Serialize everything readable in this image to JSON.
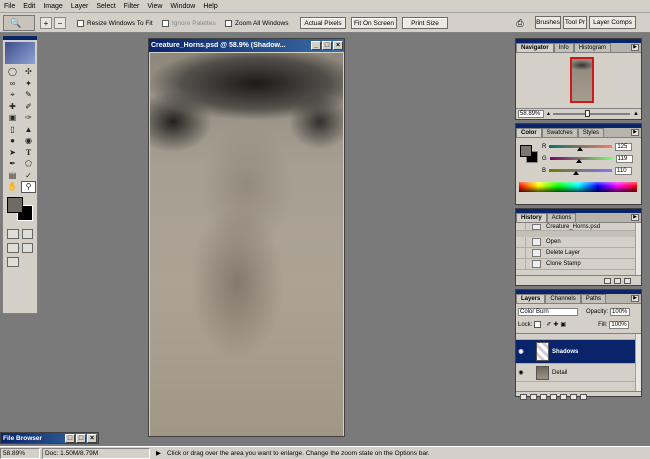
{
  "menu": [
    "File",
    "Edit",
    "Image",
    "Layer",
    "Select",
    "Filter",
    "View",
    "Window",
    "Help"
  ],
  "options": {
    "resize_windows_label": "Resize Windows To Fit",
    "ignore_palettes_label": "Ignore Palettes",
    "zoom_all_label": "Zoom All Windows",
    "actual_pixels_label": "Actual Pixels",
    "fit_on_screen_label": "Fit On Screen",
    "print_size_label": "Print Size",
    "well_tabs": [
      "Brushes",
      "Tool Pr",
      "Layer Comps"
    ]
  },
  "document": {
    "title": "Creature_Horns.psd @ 58.9% (Shadow..."
  },
  "navigator": {
    "tabs": [
      "Navigator",
      "Info",
      "Histogram"
    ],
    "zoom": "58.89%"
  },
  "color": {
    "tabs": [
      "Color",
      "Swatches",
      "Styles"
    ],
    "r_label": "R",
    "g_label": "G",
    "b_label": "B",
    "r": "125",
    "g": "119",
    "b": "110",
    "r_fraction": 0.49,
    "g_fraction": 0.47,
    "b_fraction": 0.43
  },
  "history": {
    "tabs": [
      "History",
      "Actions"
    ],
    "snapshot": "Creature_Horns.psd",
    "items": [
      "Open",
      "Delete Layer",
      "Clone Stamp"
    ]
  },
  "layers": {
    "tabs": [
      "Layers",
      "Channels",
      "Paths"
    ],
    "blend_mode": "Color Burn",
    "opacity_label": "Opacity:",
    "opacity": "100%",
    "lock_label": "Lock:",
    "fill_label": "Fill:",
    "fill": "100%",
    "items": [
      "Shadows",
      "Detail"
    ]
  },
  "file_browser": {
    "title": "File Browser"
  },
  "status": {
    "zoom": "58.89%",
    "doc": "Doc: 1.50M/8.79M",
    "hint": "Click or drag over the area you want to enlarge. Change the zoom state on the Options bar."
  },
  "colors": {
    "accent": "#0a246a",
    "chrome": "#d4d0c8",
    "workspace": "#7a7a7a"
  }
}
